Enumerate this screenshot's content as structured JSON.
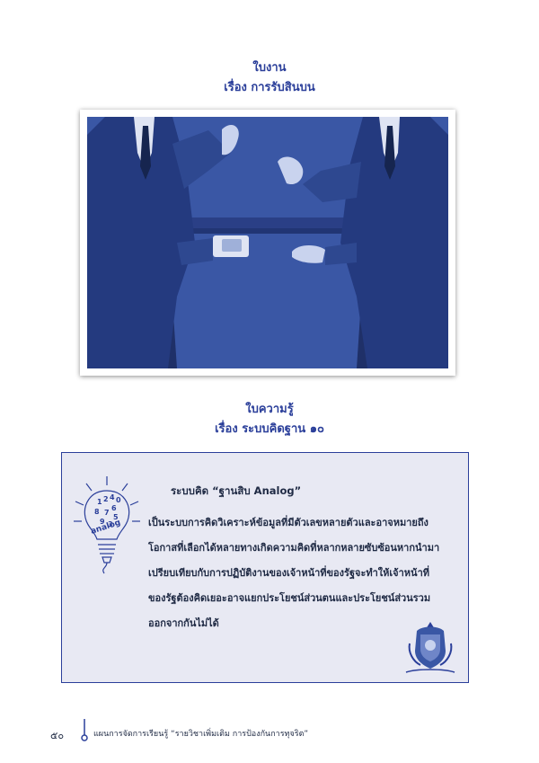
{
  "worksheet": {
    "title": "ใบงาน",
    "subtitle": "เรื่อง การรับสินบน"
  },
  "knowledge_sheet": {
    "title": "ใบความรู้",
    "subtitle": "เรื่อง ระบบคิดฐาน ๑๐"
  },
  "box": {
    "heading": "ระบบคิด “ฐานสิบ Analog”",
    "lines": [
      "เป็นระบบการคิดวิเคราะห์ข้อมูลที่มีตัวเลขหลายตัวและอาจหมายถึง",
      "โอกาสที่เลือกได้หลายทางเกิดความคิดที่หลากหลายซับซ้อนหากนำมา",
      "เปรียบเทียบกับการปฏิบัติงานของเจ้าหน้าที่ของรัฐจะทำให้เจ้าหน้าที่",
      "ของรัฐต้องคิดเยอะอาจแยกประโยชน์ส่วนตนและประโยชน์ส่วนรวม",
      "ออกจากกันไม่ได้"
    ],
    "bulb_digits": [
      "1",
      "2",
      "4",
      "0",
      "8",
      "6",
      "7",
      "5",
      "9",
      "3"
    ],
    "bulb_word": "analog"
  },
  "footer": {
    "page_number": "๕๐",
    "text": "แผนการจัดการเรียนรู้ “รายวิชาเพิ่มเติม การป้องกันการทุจริต”"
  },
  "colors": {
    "brand_blue": "#2b3f9a",
    "illustration_bg": "#3a57a5",
    "box_bg": "#e8e9f3"
  }
}
